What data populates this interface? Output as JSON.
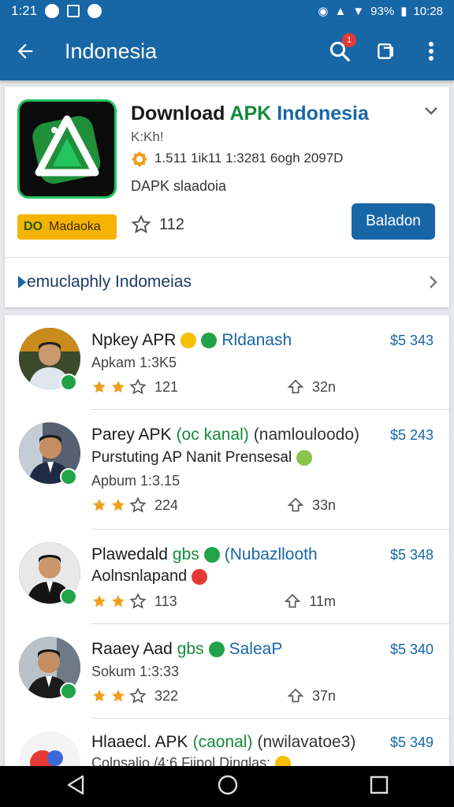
{
  "status": {
    "time_left": "1:21",
    "battery": "93%",
    "time_right": "10:28"
  },
  "appbar": {
    "title": "Indonesia",
    "notification_count": "1"
  },
  "featured": {
    "title_part1": "Download ",
    "title_part2": "APK ",
    "title_part3": "Indonesia",
    "subtitle": "K:Kh!",
    "meta": "1.511 1ik11 1:3281 6ogh 2097D",
    "developer": "DAPK slaadoia",
    "tag_prefix": "DO",
    "tag_label": "Madaoka",
    "rating": "112",
    "install_label": "Baladon",
    "more_link": "emuclaphly Indomeias"
  },
  "items": [
    {
      "name": "Npkey APR",
      "name_highlight": "Rldanash",
      "sub": "Apkam 1:3K5",
      "sub2": "",
      "rating": "121",
      "downloads": "32n",
      "price": "$5 343"
    },
    {
      "name": "Parey APK",
      "name_highlight": "(oc kanal)",
      "name_tail": "(namlouloodo)",
      "sub": "Purstuting AP Nanit Prensesal",
      "sub2": "Apbum 1:3.15",
      "rating": "224",
      "downloads": "33n",
      "price": "$5 243"
    },
    {
      "name": "Plawedald",
      "name_highlight": "gbs",
      "name_tail": "(Nubazllooth",
      "sub": "Aolnsnlapand",
      "sub2": "",
      "rating": "113",
      "downloads": "11m",
      "price": "$5 348"
    },
    {
      "name": "Raaey Aad",
      "name_highlight": "gbs",
      "name_tail": "SaleaP",
      "sub": "Sokum 1:3:33",
      "sub2": "",
      "rating": "322",
      "downloads": "37n",
      "price": "$5 340"
    },
    {
      "name": "Hlaaecl. APK",
      "name_highlight": "(caonal)",
      "name_tail": "(nwilavatoe3)",
      "sub": "Colnsalio /4:6 Fiipol Dinglas:",
      "sub2": "",
      "rating": "",
      "downloads": "",
      "price": "$5 349"
    }
  ],
  "colors": {
    "primary": "#1766a6",
    "accent_green": "#22c55e",
    "tag_yellow": "#f6b400",
    "star": "#f29d1a"
  }
}
